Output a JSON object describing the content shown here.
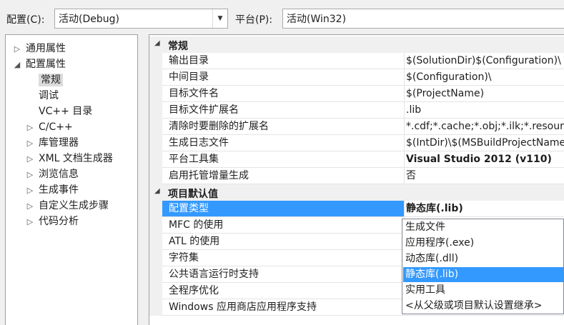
{
  "toolbar": {
    "config_label": "配置(C):",
    "config_value": "活动(Debug)",
    "platform_label": "平台(P):",
    "platform_value": "活动(Win32)"
  },
  "tree": [
    {
      "label": "通用属性",
      "arrow": "▷",
      "indent": 0,
      "selected": false
    },
    {
      "label": "配置属性",
      "arrow": "◢",
      "indent": 0,
      "selected": false
    },
    {
      "label": "常规",
      "arrow": "",
      "indent": 1,
      "selected": true
    },
    {
      "label": "调试",
      "arrow": "",
      "indent": 1,
      "selected": false
    },
    {
      "label": "VC++ 目录",
      "arrow": "",
      "indent": 1,
      "selected": false
    },
    {
      "label": "C/C++",
      "arrow": "▷",
      "indent": 1,
      "selected": false
    },
    {
      "label": "库管理器",
      "arrow": "▷",
      "indent": 1,
      "selected": false
    },
    {
      "label": "XML 文档生成器",
      "arrow": "▷",
      "indent": 1,
      "selected": false
    },
    {
      "label": "浏览信息",
      "arrow": "▷",
      "indent": 1,
      "selected": false
    },
    {
      "label": "生成事件",
      "arrow": "▷",
      "indent": 1,
      "selected": false
    },
    {
      "label": "自定义生成步骤",
      "arrow": "▷",
      "indent": 1,
      "selected": false
    },
    {
      "label": "代码分析",
      "arrow": "▷",
      "indent": 1,
      "selected": false
    }
  ],
  "grid": {
    "sections": [
      {
        "title": "常规",
        "rows": [
          {
            "name": "输出目录",
            "value": "$(SolutionDir)$(Configuration)\\",
            "bold": false
          },
          {
            "name": "中间目录",
            "value": "$(Configuration)\\",
            "bold": false
          },
          {
            "name": "目标文件名",
            "value": "$(ProjectName)",
            "bold": false
          },
          {
            "name": "目标文件扩展名",
            "value": ".lib",
            "bold": false
          },
          {
            "name": "清除时要删除的扩展名",
            "value": "*.cdf;*.cache;*.obj;*.ilk;*.resources",
            "bold": false
          },
          {
            "name": "生成日志文件",
            "value": "$(IntDir)\\$(MSBuildProjectName).log",
            "bold": false
          },
          {
            "name": "平台工具集",
            "value": "Visual Studio 2012 (v110)",
            "bold": true
          },
          {
            "name": "启用托管增量生成",
            "value": "否",
            "bold": false
          }
        ]
      },
      {
        "title": "项目默认值",
        "rows": [
          {
            "name": "配置类型",
            "value": "静态库(.lib)",
            "bold": true,
            "selected": true
          },
          {
            "name": "MFC 的使用",
            "value": "",
            "bold": false
          },
          {
            "name": "ATL 的使用",
            "value": "",
            "bold": false
          },
          {
            "name": "字符集",
            "value": "",
            "bold": false
          },
          {
            "name": "公共语言运行时支持",
            "value": "",
            "bold": false
          },
          {
            "name": "全程序优化",
            "value": "",
            "bold": false
          },
          {
            "name": "Windows 应用商店应用程序支持",
            "value": "",
            "bold": false
          }
        ]
      }
    ]
  },
  "dropdown": {
    "options": [
      {
        "label": "生成文件",
        "selected": false
      },
      {
        "label": "应用程序(.exe)",
        "selected": false
      },
      {
        "label": "动态库(.dll)",
        "selected": false
      },
      {
        "label": "静态库(.lib)",
        "selected": true
      },
      {
        "label": "实用工具",
        "selected": false
      },
      {
        "label": "<从父级或项目默认设置继承>",
        "selected": false
      }
    ]
  }
}
